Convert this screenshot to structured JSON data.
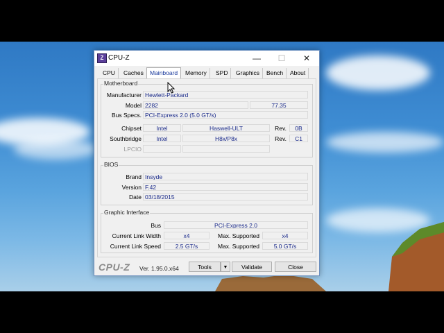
{
  "window": {
    "title": "CPU-Z",
    "app_icon_glyph": "Z",
    "minimize_glyph": "—",
    "maximize_glyph": "☐",
    "close_glyph": "✕"
  },
  "tabs": [
    {
      "label": "CPU"
    },
    {
      "label": "Caches"
    },
    {
      "label": "Mainboard",
      "active": true
    },
    {
      "label": "Memory"
    },
    {
      "label": "SPD"
    },
    {
      "label": "Graphics"
    },
    {
      "label": "Bench"
    },
    {
      "label": "About"
    }
  ],
  "motherboard": {
    "title": "Motherboard",
    "manufacturer_label": "Manufacturer",
    "manufacturer": "Hewlett-Packard",
    "model_label": "Model",
    "model": "2282",
    "model_rev": "77.35",
    "bus_specs_label": "Bus Specs.",
    "bus_specs": "PCI-Express 2.0 (5.0 GT/s)",
    "chipset_label": "Chipset",
    "chipset_vendor": "Intel",
    "chipset_name": "Haswell-ULT",
    "chipset_rev_label": "Rev.",
    "chipset_rev": "0B",
    "southbridge_label": "Southbridge",
    "southbridge_vendor": "Intel",
    "southbridge_name": "H8x/P8x",
    "southbridge_rev_label": "Rev.",
    "southbridge_rev": "C1",
    "lpcio_label": "LPCIO"
  },
  "bios": {
    "title": "BIOS",
    "brand_label": "Brand",
    "brand": "Insyde",
    "version_label": "Version",
    "version": "F.42",
    "date_label": "Date",
    "date": "03/18/2015"
  },
  "graphic_interface": {
    "title": "Graphic Interface",
    "bus_label": "Bus",
    "bus": "PCI-Express 2.0",
    "link_width_label": "Current Link Width",
    "link_width": "x4",
    "max_width_label": "Max. Supported",
    "max_width": "x4",
    "link_speed_label": "Current Link Speed",
    "link_speed": "2.5 GT/s",
    "max_speed_label": "Max. Supported",
    "max_speed": "5.0 GT/s"
  },
  "footer": {
    "logo": "CPU-Z",
    "version": "Ver. 1.95.0.x64",
    "tools_label": "Tools",
    "tools_arrow": "▼",
    "validate_label": "Validate",
    "close_label": "Close"
  }
}
